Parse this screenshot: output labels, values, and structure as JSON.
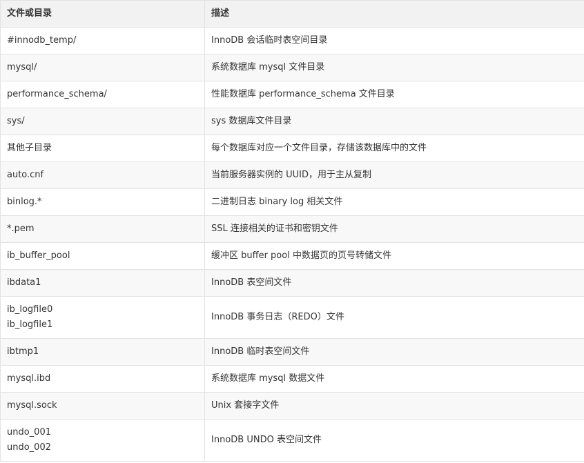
{
  "table": {
    "headers": [
      "文件或目录",
      "描述"
    ],
    "rows": [
      {
        "name": [
          "#innodb_temp/"
        ],
        "desc": "InnoDB 会话临时表空间目录"
      },
      {
        "name": [
          "mysql/"
        ],
        "desc": "系统数据库 mysql 文件目录"
      },
      {
        "name": [
          "performance_schema/"
        ],
        "desc": "性能数据库 performance_schema 文件目录"
      },
      {
        "name": [
          "sys/"
        ],
        "desc": "sys 数据库文件目录"
      },
      {
        "name": [
          "其他子目录"
        ],
        "desc": "每个数据库对应一个文件目录，存储该数据库中的文件"
      },
      {
        "name": [
          "auto.cnf"
        ],
        "desc": "当前服务器实例的 UUID，用于主从复制"
      },
      {
        "name": [
          "binlog.*"
        ],
        "desc": "二进制日志 binary log 相关文件"
      },
      {
        "name": [
          "*.pem"
        ],
        "desc": "SSL 连接相关的证书和密钥文件"
      },
      {
        "name": [
          "ib_buffer_pool"
        ],
        "desc": "缓冲区 buffer pool 中数据页的页号转储文件"
      },
      {
        "name": [
          "ibdata1"
        ],
        "desc": "InnoDB 表空间文件"
      },
      {
        "name": [
          "ib_logfile0",
          "ib_logfile1"
        ],
        "desc": "InnoDB 事务日志（REDO）文件"
      },
      {
        "name": [
          "ibtmp1"
        ],
        "desc": "InnoDB 临时表空间文件"
      },
      {
        "name": [
          "mysql.ibd"
        ],
        "desc": "系统数据库 mysql 数据文件"
      },
      {
        "name": [
          "mysql.sock"
        ],
        "desc": "Unix 套接字文件"
      },
      {
        "name": [
          "undo_001",
          "undo_002"
        ],
        "desc": "InnoDB UNDO 表空间文件"
      }
    ]
  }
}
